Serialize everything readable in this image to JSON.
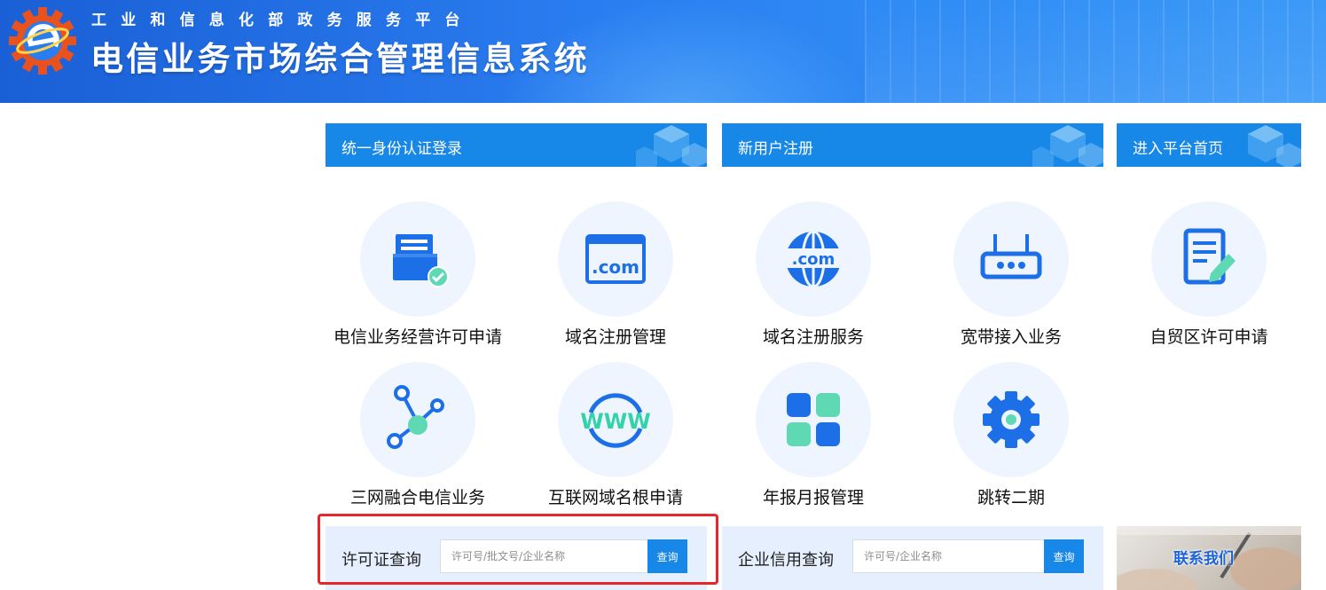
{
  "header": {
    "subtitle": "工业和信息化部政务服务平台",
    "title": "电信业务市场综合管理信息系统",
    "brand_color": "#2a7df0"
  },
  "topbar": {
    "login": "统一身份认证登录",
    "register": "新用户注册",
    "home": "进入平台首页"
  },
  "services": [
    {
      "label": "电信业务经营许可申请",
      "icon": "license-form-icon"
    },
    {
      "label": "域名注册管理",
      "icon": "browser-com-icon"
    },
    {
      "label": "域名注册服务",
      "icon": "globe-com-icon"
    },
    {
      "label": "宽带接入业务",
      "icon": "router-icon"
    },
    {
      "label": "自贸区许可申请",
      "icon": "document-edit-icon"
    },
    {
      "label": "三网融合电信业务",
      "icon": "network-nodes-icon"
    },
    {
      "label": "互联网域名根申请",
      "icon": "www-icon"
    },
    {
      "label": "年报月报管理",
      "icon": "grid-blocks-icon"
    },
    {
      "label": "跳转二期",
      "icon": "gear-icon"
    }
  ],
  "license_query": {
    "label": "许可证查询",
    "placeholder": "许可号/批文号/企业名称",
    "button": "查询"
  },
  "credit_query": {
    "label": "企业信用查询",
    "placeholder": "许可号/企业名称",
    "button": "查询"
  },
  "contact": {
    "label": "联系我们"
  },
  "colors": {
    "accent": "#1787e8",
    "icon_blue": "#1d6fe8",
    "icon_green": "#5fd8b4",
    "highlight": "#e8262a"
  }
}
